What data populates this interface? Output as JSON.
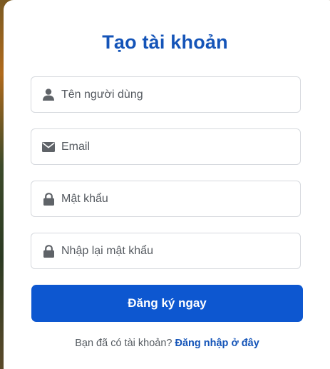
{
  "form": {
    "title": "Tạo tài khoản",
    "fields": [
      {
        "icon": "user-icon",
        "placeholder": "Tên người dùng"
      },
      {
        "icon": "envelope-icon",
        "placeholder": "Email"
      },
      {
        "icon": "lock-icon",
        "placeholder": "Mật khẩu"
      },
      {
        "icon": "lock-icon",
        "placeholder": "Nhập lại mật khẩu"
      }
    ],
    "submit_label": "Đăng ký ngay",
    "footer_text": "Bạn đã có tài khoản?",
    "login_link": "Đăng nhập ở đây"
  },
  "colors": {
    "accent": "#1454b8",
    "button": "#0d57d0",
    "icon": "#5f6368"
  }
}
